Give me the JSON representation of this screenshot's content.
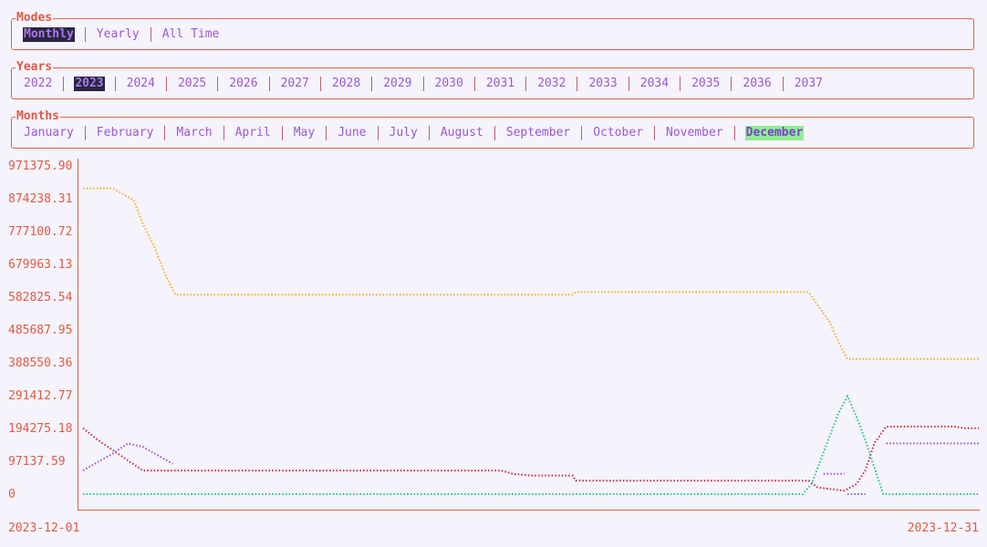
{
  "modes": {
    "title": "Modes",
    "items": [
      "Monthly",
      "Yearly",
      "All Time"
    ],
    "selected": 0
  },
  "years": {
    "title": "Years",
    "items": [
      "2022",
      "2023",
      "2024",
      "2025",
      "2026",
      "2027",
      "2028",
      "2029",
      "2030",
      "2031",
      "2032",
      "2033",
      "2034",
      "2035",
      "2036",
      "2037"
    ],
    "selected": 1
  },
  "months": {
    "title": "Months",
    "items": [
      "January",
      "February",
      "March",
      "April",
      "May",
      "June",
      "July",
      "August",
      "September",
      "October",
      "November",
      "December"
    ],
    "selected": 11
  },
  "colors": {
    "accent": "#e05a44",
    "tab_text": "#9b59d0",
    "selected_dark_bg": "#2a2540",
    "selected_green_bg": "#90ee90"
  },
  "chart_data": {
    "type": "line",
    "xlabel": "",
    "ylabel": "",
    "x_start_label": "2023-12-01",
    "x_end_label": "2023-12-31",
    "xlim": [
      1,
      31
    ],
    "ylim": [
      0,
      971375.9
    ],
    "y_ticks": [
      "971375.90",
      "874238.31",
      "777100.72",
      "679963.13",
      "582825.54",
      "485687.95",
      "388550.36",
      "291412.77",
      "194275.18",
      "97137.59",
      "0"
    ],
    "grid": false,
    "series": [
      {
        "color": "#f5b020",
        "points": [
          [
            1,
            905000
          ],
          [
            2,
            905000
          ],
          [
            2.7,
            870000
          ],
          [
            3,
            800000
          ],
          [
            3.4,
            730000
          ],
          [
            3.8,
            640000
          ],
          [
            4.1,
            590000
          ],
          [
            17.4,
            590000
          ],
          [
            17.5,
            598000
          ],
          [
            25.3,
            598000
          ],
          [
            25.6,
            560000
          ],
          [
            26,
            510000
          ],
          [
            26.3,
            450000
          ],
          [
            26.6,
            400000
          ],
          [
            31,
            400000
          ]
        ]
      },
      {
        "color": "#c8283c",
        "points": [
          [
            1,
            195000
          ],
          [
            1.5,
            160000
          ],
          [
            2,
            130000
          ],
          [
            2.5,
            100000
          ],
          [
            3,
            70000
          ],
          [
            15,
            70000
          ],
          [
            15.4,
            60000
          ],
          [
            16,
            55000
          ],
          [
            17.4,
            55000
          ],
          [
            17.5,
            40000
          ],
          [
            25.3,
            40000
          ],
          [
            25.6,
            20000
          ],
          [
            26.5,
            10000
          ],
          [
            26.9,
            30000
          ],
          [
            27.2,
            70000
          ],
          [
            27.5,
            150000
          ],
          [
            27.9,
            200000
          ],
          [
            30.2,
            200000
          ],
          [
            30.5,
            195000
          ],
          [
            31,
            195000
          ]
        ]
      },
      {
        "color": "#a050d0",
        "points": [
          [
            1,
            70000
          ],
          [
            1.4,
            90000
          ],
          [
            2,
            120000
          ],
          [
            2.5,
            150000
          ],
          [
            3,
            140000
          ],
          [
            3.6,
            110000
          ],
          [
            4,
            90000
          ]
        ]
      },
      {
        "color": "#a050d0",
        "points": [
          [
            25.8,
            60000
          ],
          [
            26.5,
            60000
          ]
        ]
      },
      {
        "color": "#a050d0",
        "points": [
          [
            27.9,
            150000
          ],
          [
            31,
            150000
          ]
        ]
      },
      {
        "color": "#7060d0",
        "points": [
          [
            26.6,
            0
          ],
          [
            27.2,
            0
          ]
        ]
      },
      {
        "color": "#20c090",
        "points": [
          [
            1,
            0
          ],
          [
            25.1,
            0
          ],
          [
            25.4,
            30000
          ],
          [
            25.7,
            100000
          ],
          [
            26,
            170000
          ],
          [
            26.3,
            240000
          ],
          [
            26.6,
            290000
          ],
          [
            26.9,
            230000
          ],
          [
            27.2,
            160000
          ],
          [
            27.5,
            80000
          ],
          [
            27.8,
            0
          ],
          [
            31,
            0
          ]
        ]
      }
    ]
  }
}
